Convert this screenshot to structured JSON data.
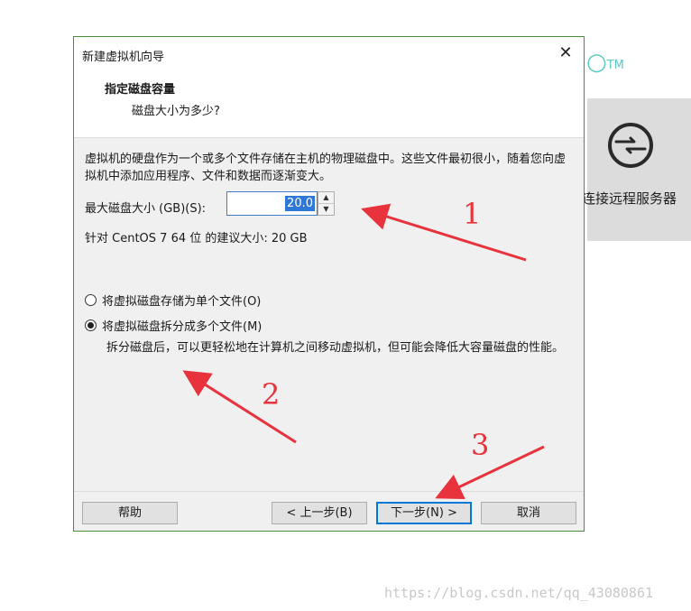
{
  "background_app": {
    "logo_tm": "TM",
    "panel_label": "连接远程服务器",
    "panel_icon": "connect-icon"
  },
  "dialog": {
    "title": "新建虚拟机向导",
    "heading": "指定磁盘容量",
    "subheading": "磁盘大小为多少?",
    "description": "虚拟机的硬盘作为一个或多个文件存储在主机的物理磁盘中。这些文件最初很小，随着您向虚拟机中添加应用程序、文件和数据而逐渐变大。",
    "max_size_label": "最大磁盘大小 (GB)(S):",
    "max_size_value": "20.0",
    "recommendation": "针对 CentOS 7 64 位 的建议大小: 20 GB",
    "radio_single": "将虚拟磁盘存储为单个文件(O)",
    "radio_split": "将虚拟磁盘拆分成多个文件(M)",
    "split_note": "拆分磁盘后，可以更轻松地在计算机之间移动虚拟机，但可能会降低大容量磁盘的性能。",
    "buttons": {
      "help": "帮助",
      "back": "< 上一步(B)",
      "next": "下一步(N) >",
      "cancel": "取消"
    }
  },
  "annotations": [
    "1",
    "2",
    "3"
  ],
  "colors": {
    "arrow": "#e8323c",
    "accent": "#0078d7",
    "logo": "#5cc9c2"
  },
  "watermark": "https://blog.csdn.net/qq_43080861"
}
